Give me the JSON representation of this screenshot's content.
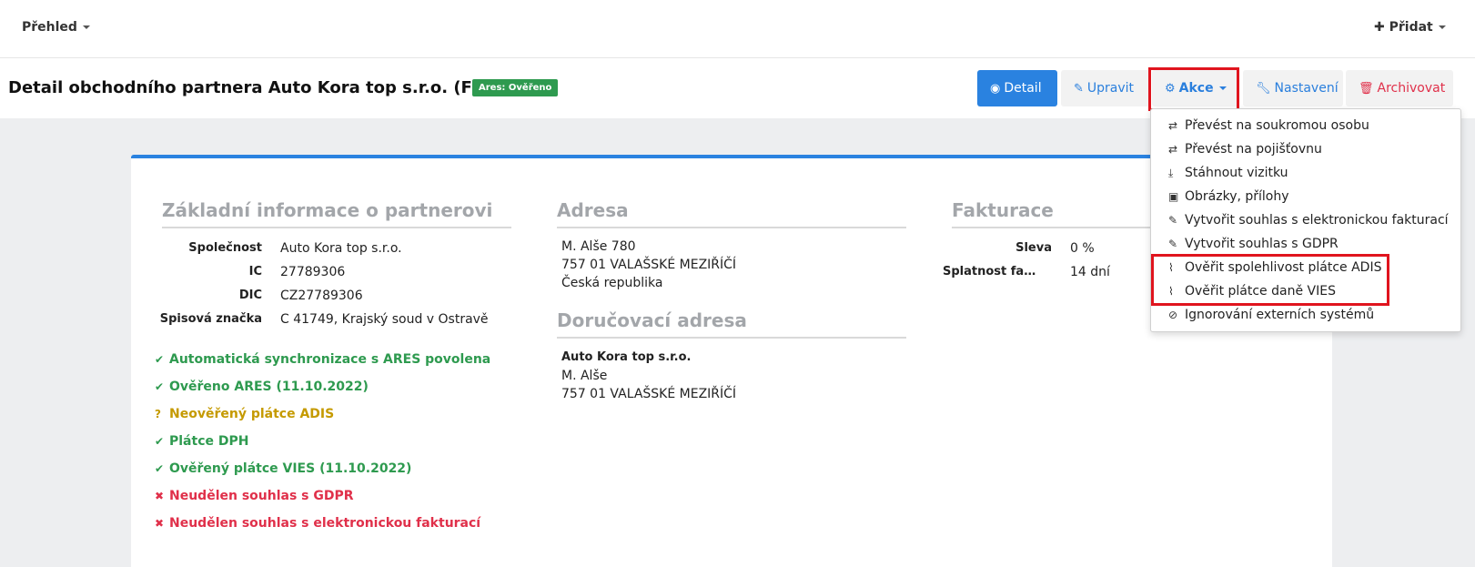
{
  "nav": {
    "overview_label": "Přehled",
    "add_label": "Přidat",
    "add_icon": "plus-icon"
  },
  "header": {
    "title": "Detail obchodního partnera Auto Kora top s.r.o. (Firma)",
    "badge": "Ares: Ověřeno",
    "buttons": {
      "detail": "Detail",
      "upravit": "Upravit",
      "akce": "Akce",
      "nastaveni": "Nastavení",
      "archivovat": "Archivovat"
    }
  },
  "colors": {
    "primary": "#2a82e0",
    "success": "#2e9a4f",
    "warning": "#c59a00",
    "danger": "#e0304a",
    "highlight": "#e0141e"
  },
  "basic_info": {
    "title": "Základní informace o partnerovi",
    "rows": [
      {
        "label": "Společnost",
        "value": "Auto Kora top s.r.o."
      },
      {
        "label": "IČ",
        "value": "27789306"
      },
      {
        "label": "DIČ",
        "value": "CZ27789306"
      },
      {
        "label": "Spisová značka",
        "value": "C 41749, Krajský soud v Ostravě"
      }
    ]
  },
  "statuses": [
    {
      "text": "Automatická synchronizace s ARES povolena",
      "type": "success",
      "icon": "check-icon"
    },
    {
      "text": "Ověřeno ARES (11.10.2022)",
      "type": "success",
      "icon": "check-icon"
    },
    {
      "text": "Neověřený plátce ADIS",
      "type": "warning",
      "icon": "question-icon"
    },
    {
      "text": "Plátce DPH",
      "type": "success",
      "icon": "check-icon"
    },
    {
      "text": "Ověřený plátce VIES (11.10.2022)",
      "type": "success",
      "icon": "check-icon"
    },
    {
      "text": "Neudělen souhlas s GDPR",
      "type": "danger",
      "icon": "cross-icon"
    },
    {
      "text": "Neudělen souhlas s elektronickou fakturací",
      "type": "danger",
      "icon": "cross-icon"
    }
  ],
  "address": {
    "title": "Adresa",
    "lines": [
      "M. Alše 780",
      "757 01 VALAŠSKÉ MEZIŘÍČÍ",
      "Česká republika"
    ]
  },
  "delivery_address": {
    "title": "Doručovací adresa",
    "company": "Auto Kora top s.r.o.",
    "lines": [
      "M. Alše",
      "757 01 VALAŠSKÉ MEZIŘÍČÍ"
    ]
  },
  "billing": {
    "title": "Fakturace",
    "rows": [
      {
        "label": "Sleva",
        "value": "0 %"
      },
      {
        "label": "Splatnost faktur",
        "value": "14 dní"
      }
    ]
  },
  "dropdown": {
    "items": [
      {
        "label": "Převést na soukromou osobu",
        "icon": "exchange-icon"
      },
      {
        "label": "Převést na pojišťovnu",
        "icon": "exchange-icon"
      },
      {
        "label": "Stáhnout vizitku",
        "icon": "download-icon"
      },
      {
        "label": "Obrázky, přílohy",
        "icon": "image-file-icon"
      },
      {
        "label": "Vytvořit souhlas s elektronickou fakturací",
        "icon": "pencil-icon"
      },
      {
        "label": "Vytvořit souhlas s GDPR",
        "icon": "pencil-icon"
      },
      {
        "label": "Ověřit spolehlivost plátce ADIS",
        "icon": "paperclip-icon"
      },
      {
        "label": "Ověřit plátce daně VIES",
        "icon": "paperclip-icon"
      },
      {
        "label": "Ignorování externích systémů",
        "icon": "ban-icon"
      }
    ]
  }
}
